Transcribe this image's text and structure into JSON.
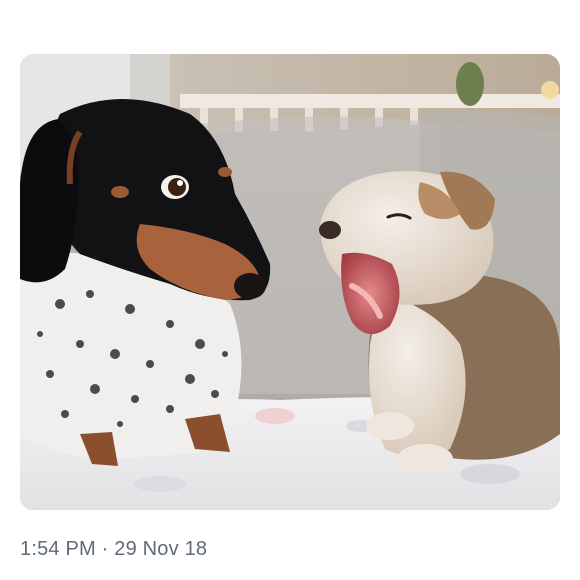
{
  "tweet": {
    "timestamp": "1:54 PM · 29 Nov 18",
    "media": {
      "kind": "photo",
      "subjects": [
        "dachshund-dog",
        "yawning-puppy"
      ]
    }
  },
  "colors": {
    "timestamp_text": "#5f6b77",
    "background": "#ffffff"
  }
}
